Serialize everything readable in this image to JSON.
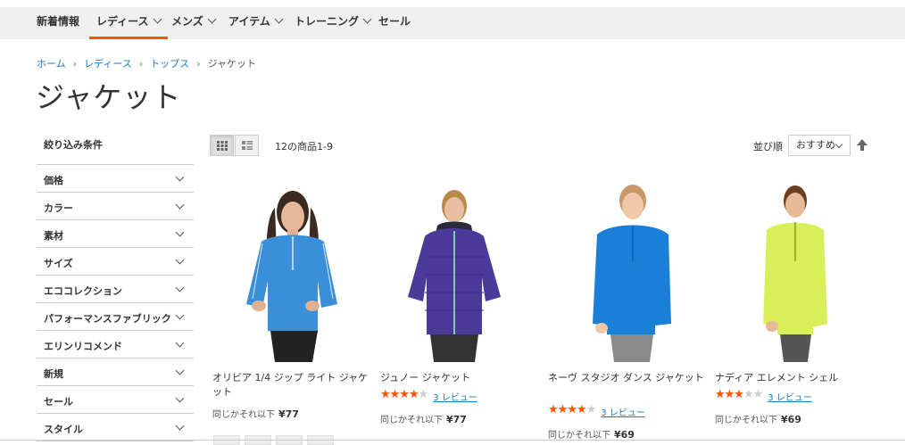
{
  "nav": {
    "items": [
      {
        "label": "新着情報",
        "dropdown": false
      },
      {
        "label": "レディース",
        "dropdown": true
      },
      {
        "label": "メンズ",
        "dropdown": true
      },
      {
        "label": "アイテム",
        "dropdown": true
      },
      {
        "label": "トレーニング",
        "dropdown": true
      },
      {
        "label": "セール",
        "dropdown": false
      }
    ],
    "active": "レディース",
    "accent": "#ff5501"
  },
  "breadcrumb": {
    "items": [
      "ホーム",
      "レディース",
      "トップス"
    ],
    "current": "ジャケット",
    "separator": "›"
  },
  "page_title": "ジャケット",
  "sidebar": {
    "title": "絞り込み条件",
    "filters": [
      "価格",
      "カラー",
      "素材",
      "サイズ",
      "エココレクション",
      "パフォーマンスファブリック",
      "エリンリコメンド",
      "新規",
      "セール",
      "スタイル"
    ]
  },
  "toolbar": {
    "view_modes": [
      "grid-icon",
      "list-icon"
    ],
    "amount": "12の商品1-9",
    "sort_label": "並び順",
    "sort_value": "おすすめ",
    "sort_direction_icon": "arrow-up-icon"
  },
  "products": [
    {
      "name": "オリビア 1/4 ジップ ライト ジャケット",
      "price_label": "同じかそれ以下",
      "price": "¥77",
      "rating": null,
      "reviews": null,
      "color": "#3a8fd8"
    },
    {
      "name": "ジュノー ジャケット",
      "price_label": "同じかそれ以下",
      "price": "¥77",
      "rating": 0.8,
      "reviews": "3 レビュー",
      "color": "#4b3a9a"
    },
    {
      "name": "ネーヴ スタジオ ダンス ジャケット",
      "price_label": "同じかそれ以下",
      "price": "¥69",
      "rating": 0.8,
      "reviews": "3 レビュー",
      "color": "#1a7fd6"
    },
    {
      "name": "ナディア エレメント シェル",
      "price_label": "同じかそれ以下",
      "price": "¥69",
      "rating": 0.6,
      "reviews": "3 レビュー",
      "color": "#d9ef5a"
    }
  ]
}
